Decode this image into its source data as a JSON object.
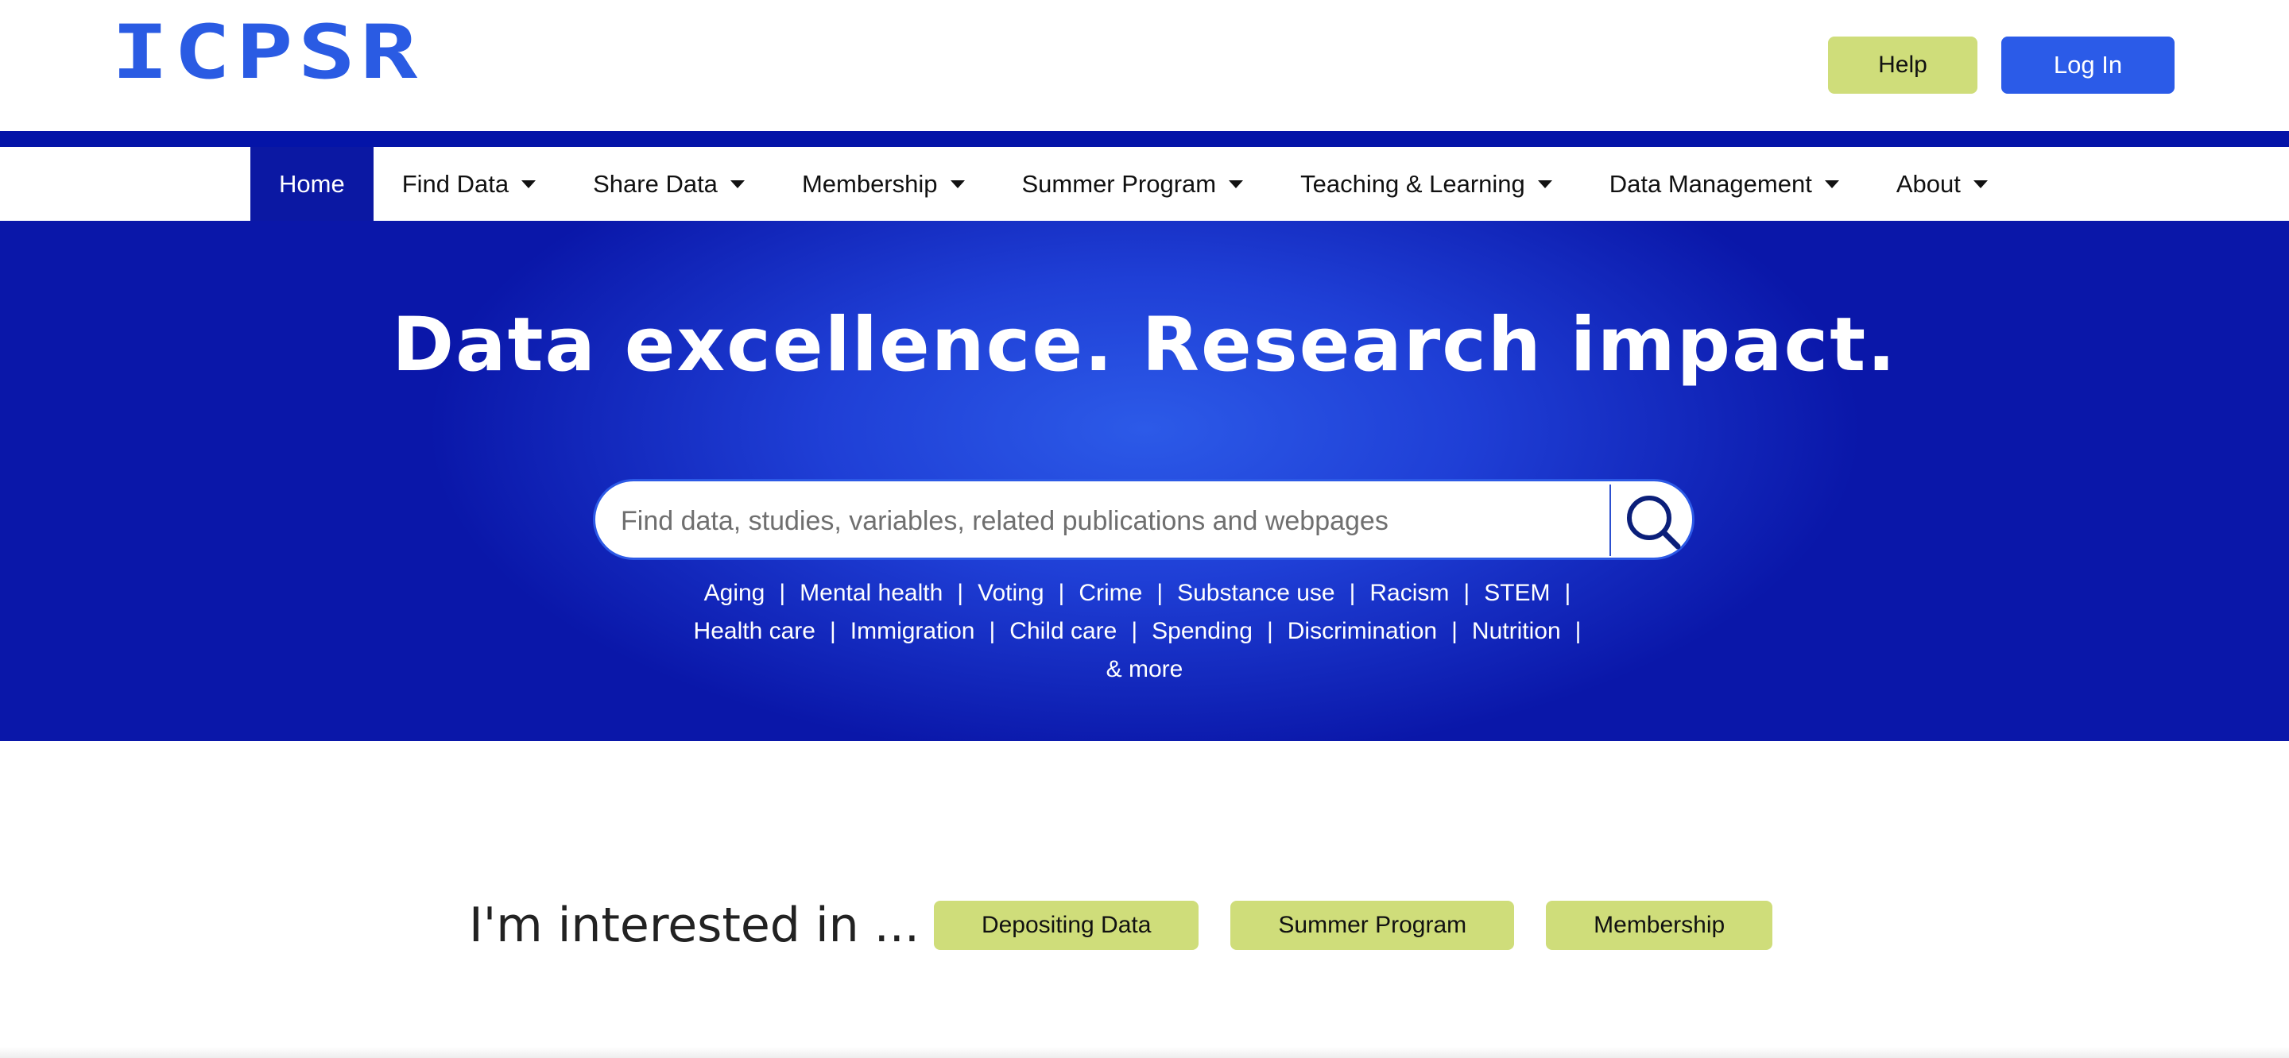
{
  "header": {
    "logo_text": "ICPSR",
    "help_label": "Help",
    "login_label": "Log In"
  },
  "nav": {
    "items": [
      {
        "label": "Home",
        "dropdown": false,
        "active": true
      },
      {
        "label": "Find Data",
        "dropdown": true
      },
      {
        "label": "Share Data",
        "dropdown": true
      },
      {
        "label": "Membership",
        "dropdown": true
      },
      {
        "label": "Summer Program",
        "dropdown": true
      },
      {
        "label": "Teaching & Learning",
        "dropdown": true
      },
      {
        "label": "Data Management",
        "dropdown": true
      },
      {
        "label": "About",
        "dropdown": true
      }
    ]
  },
  "hero": {
    "title": "Data excellence. Research impact.",
    "search_placeholder": "Find data, studies, variables, related publications and webpages",
    "search_icon": "search-icon",
    "topics": [
      "Aging",
      "Mental health",
      "Voting",
      "Crime",
      "Substance use",
      "Racism",
      "STEM",
      "Health care",
      "Immigration",
      "Child care",
      "Spending",
      "Discrimination",
      "Nutrition"
    ],
    "more_label": "& more",
    "separator": "|"
  },
  "interested": {
    "label": "I'm interested in ...",
    "buttons": [
      "Depositing Data",
      "Summer Program",
      "Membership"
    ]
  },
  "colors": {
    "brand_blue": "#2a5be3",
    "nav_active": "#0b18a3",
    "accent_green": "#cfdd7a",
    "hero_dark": "#0a17a9"
  }
}
